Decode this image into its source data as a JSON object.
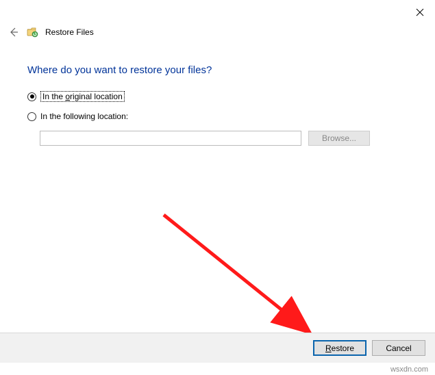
{
  "window": {
    "title": "Restore Files",
    "close_tooltip": "Close"
  },
  "page": {
    "heading": "Where do you want to restore your files?",
    "option_original_prefix": "In the ",
    "option_original_underlined": "o",
    "option_original_suffix": "riginal location",
    "option_following": "In the following location:",
    "path_value": "",
    "path_placeholder": "",
    "browse_label": "Browse..."
  },
  "footer": {
    "primary_prefix": "",
    "primary_underlined": "R",
    "primary_suffix": "estore",
    "cancel_label": "Cancel"
  },
  "watermark": "wsxdn.com"
}
